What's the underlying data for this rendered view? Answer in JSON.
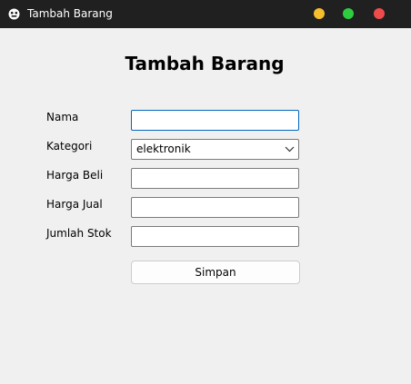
{
  "window": {
    "title": "Tambah Barang",
    "icon": "gamepad-icon",
    "controls": {
      "minimize_color": "#f6bd2d",
      "maximize_color": "#2ecc40",
      "close_color": "#f04b4b"
    }
  },
  "form": {
    "title": "Tambah Barang",
    "fields": {
      "nama": {
        "label": "Nama",
        "value": "",
        "focused": true
      },
      "kategori": {
        "label": "Kategori",
        "value": "elektronik"
      },
      "harga_beli": {
        "label": "Harga Beli",
        "value": ""
      },
      "harga_jual": {
        "label": "Harga Jual",
        "value": ""
      },
      "jumlah_stok": {
        "label": "Jumlah Stok",
        "value": ""
      }
    },
    "submit_label": "Simpan"
  }
}
